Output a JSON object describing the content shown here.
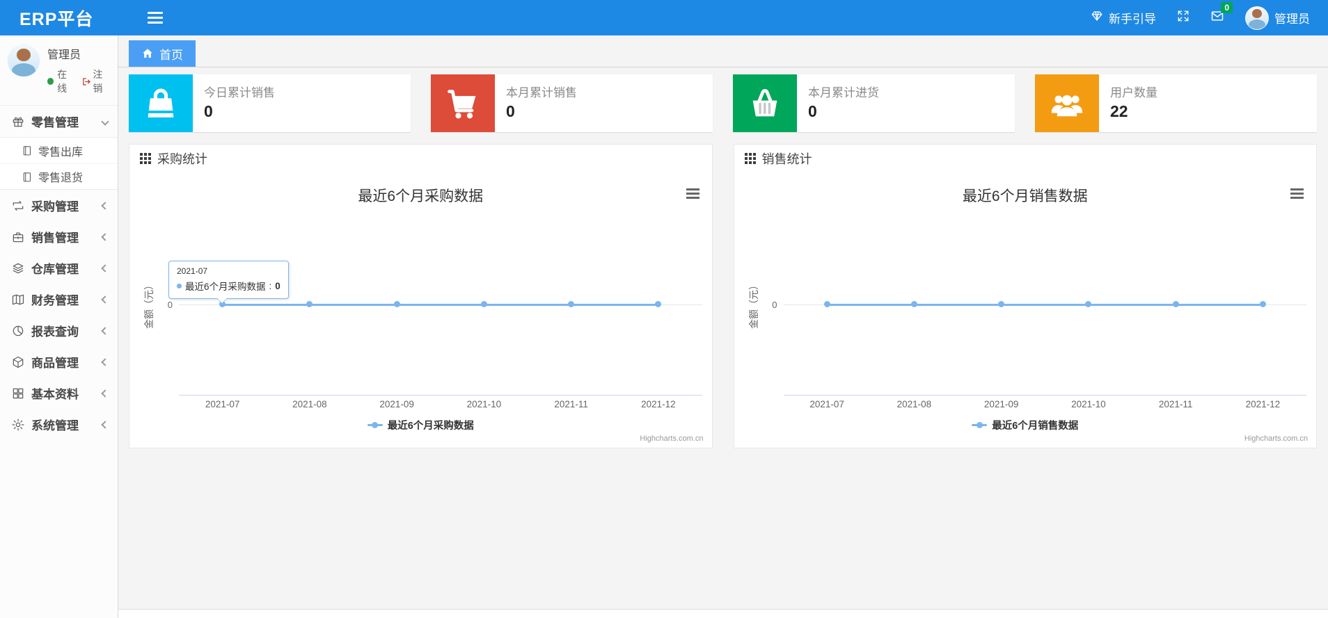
{
  "theme": {
    "navbar_bg": "#1e88e5",
    "tab_bg": "#4a9ff5",
    "series_color": "#7cb5ec"
  },
  "navbar": {
    "brand": "ERP平台",
    "guide_label": "新手引导",
    "mail_badge": "0",
    "user_name": "管理员"
  },
  "sidebar": {
    "user": {
      "name": "管理员",
      "status": "在线",
      "logout_label": "注销"
    },
    "menu": [
      {
        "label": "零售管理",
        "expanded": true,
        "children": [
          "零售出库",
          "零售退货"
        ]
      },
      {
        "label": "采购管理"
      },
      {
        "label": "销售管理"
      },
      {
        "label": "仓库管理"
      },
      {
        "label": "财务管理"
      },
      {
        "label": "报表查询"
      },
      {
        "label": "商品管理"
      },
      {
        "label": "基本资料"
      },
      {
        "label": "系统管理"
      }
    ]
  },
  "tabs": {
    "home": "首页"
  },
  "cards": [
    {
      "label": "今日累计销售",
      "value": "0",
      "color": "#00c0ef",
      "icon": "shopping-bag-icon"
    },
    {
      "label": "本月累计销售",
      "value": "0",
      "color": "#dd4b39",
      "icon": "shopping-cart-icon"
    },
    {
      "label": "本月累计进货",
      "value": "0",
      "color": "#00a65a",
      "icon": "shopping-basket-icon"
    },
    {
      "label": "用户数量",
      "value": "22",
      "color": "#f39c12",
      "icon": "users-icon"
    }
  ],
  "panels": [
    {
      "title": "采购统计"
    },
    {
      "title": "销售统计"
    }
  ],
  "chart_data": [
    {
      "type": "line",
      "title": "最近6个月采购数据",
      "categories": [
        "2021-07",
        "2021-08",
        "2021-09",
        "2021-10",
        "2021-11",
        "2021-12"
      ],
      "series": [
        {
          "name": "最近6个月采购数据",
          "values": [
            0,
            0,
            0,
            0,
            0,
            0
          ],
          "color": "#7cb5ec"
        }
      ],
      "ylabel": "金额（元）",
      "yticks": [
        "0"
      ],
      "ylim": [
        -1,
        1
      ],
      "grid": true,
      "legend_position": "bottom",
      "credits": "Highcharts.com.cn",
      "tooltip": {
        "category": "2021-07",
        "series": "最近6个月采购数据",
        "separator": ":",
        "value": "0"
      }
    },
    {
      "type": "line",
      "title": "最近6个月销售数据",
      "categories": [
        "2021-07",
        "2021-08",
        "2021-09",
        "2021-10",
        "2021-11",
        "2021-12"
      ],
      "series": [
        {
          "name": "最近6个月销售数据",
          "values": [
            0,
            0,
            0,
            0,
            0,
            0
          ],
          "color": "#7cb5ec"
        }
      ],
      "ylabel": "金额（元）",
      "yticks": [
        "0"
      ],
      "ylim": [
        -1,
        1
      ],
      "grid": true,
      "legend_position": "bottom",
      "credits": "Highcharts.com.cn"
    }
  ]
}
